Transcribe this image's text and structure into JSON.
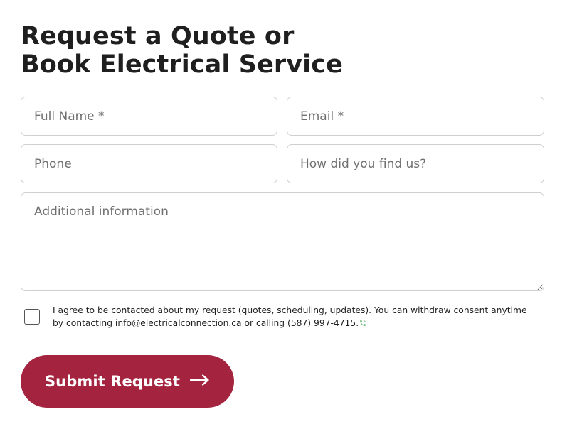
{
  "heading": {
    "line1": "Request a Quote or",
    "line2": "Book Electrical Service"
  },
  "form": {
    "full_name": {
      "placeholder": "Full Name *",
      "value": ""
    },
    "email": {
      "placeholder": "Email *",
      "value": ""
    },
    "phone": {
      "placeholder": "Phone",
      "value": ""
    },
    "found_us": {
      "placeholder": "How did you find us?",
      "value": ""
    },
    "additional": {
      "placeholder": "Additional information",
      "value": ""
    }
  },
  "consent": {
    "checked": false,
    "line1": "I agree to be contacted about my request (quotes, scheduling, updates). You can withdraw consent anytime",
    "line2": "by contacting info@electricalconnection.ca or calling (587) 997-4715."
  },
  "submit": {
    "label": "Submit Request"
  },
  "icons": {
    "phone": "phone-icon",
    "arrow": "arrow-right-icon",
    "resize": "resize-handle-icon"
  },
  "colors": {
    "accent": "#a4233e",
    "phone_icon": "#3aa34a",
    "text": "#1f1f1f",
    "border": "#cfcfcf",
    "placeholder": "#707070"
  }
}
